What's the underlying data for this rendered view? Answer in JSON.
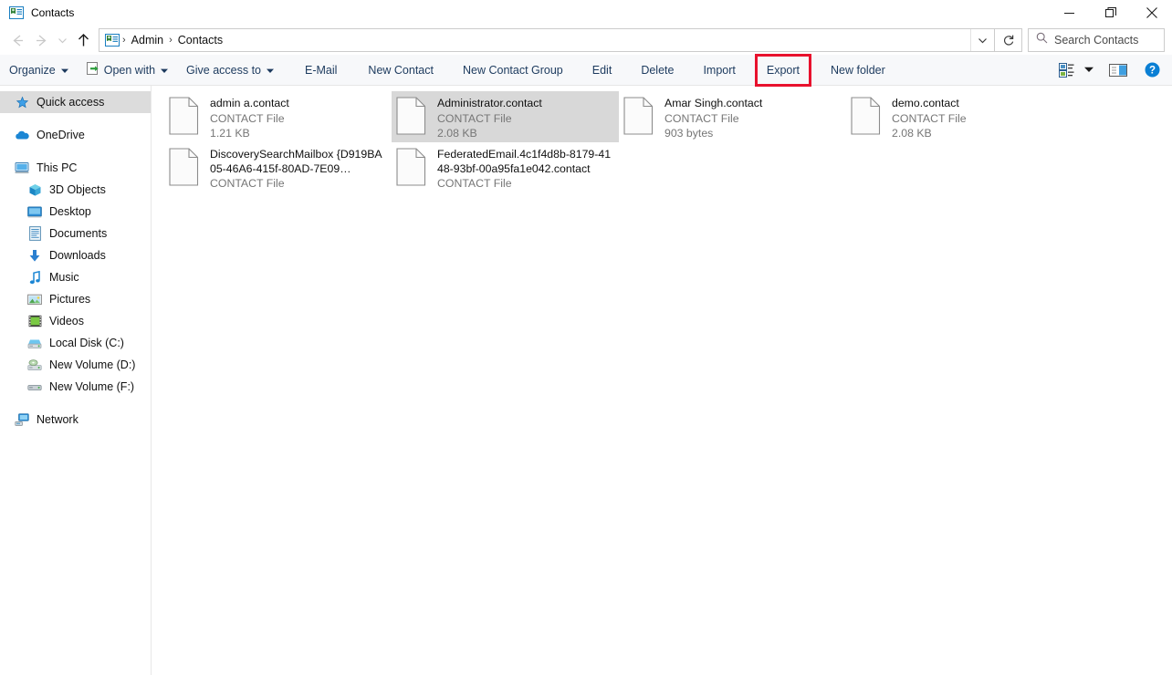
{
  "window": {
    "title": "Contacts",
    "title_icon": "contact-card-icon",
    "controls": {
      "minimize": "minimize-icon",
      "maximize": "restore-icon",
      "close": "close-icon"
    }
  },
  "addressbar": {
    "back": "back-arrow-icon",
    "forward": "forward-arrow-icon",
    "recent": "chevron-down-icon",
    "up": "up-arrow-icon",
    "path_icon": "contact-card-icon",
    "crumbs": [
      "Admin",
      "Contacts"
    ],
    "separator": "›",
    "dropdown": "chevron-down-icon",
    "refresh": "refresh-icon"
  },
  "search": {
    "icon": "search-icon",
    "placeholder": "Search Contacts",
    "value": ""
  },
  "toolbar": {
    "items": [
      {
        "label": "Organize",
        "caret": true,
        "icon": null
      },
      {
        "label": "Open with",
        "caret": true,
        "icon": "open-with-icon"
      },
      {
        "label": "Give access to",
        "caret": true,
        "icon": null
      },
      {
        "label": "E-Mail",
        "caret": false,
        "icon": null
      },
      {
        "label": "New Contact",
        "caret": false,
        "icon": null
      },
      {
        "label": "New Contact Group",
        "caret": false,
        "icon": null
      },
      {
        "label": "Edit",
        "caret": false,
        "icon": null
      },
      {
        "label": "Delete",
        "caret": false,
        "icon": null
      },
      {
        "label": "Import",
        "caret": false,
        "icon": null
      },
      {
        "label": "Export",
        "caret": false,
        "icon": null,
        "highlighted": true
      },
      {
        "label": "New folder",
        "caret": false,
        "icon": null
      }
    ],
    "right_icons": [
      "view-options-icon",
      "view-options-caret-icon",
      "preview-pane-icon",
      "help-icon"
    ],
    "highlight_color": "#e8112d"
  },
  "sidebar": {
    "items": [
      {
        "label": "Quick access",
        "icon": "star-pin-icon",
        "selected": true,
        "indent": false,
        "gap_before": false
      },
      {
        "label": "OneDrive",
        "icon": "cloud-icon",
        "selected": false,
        "indent": false,
        "gap_before": true
      },
      {
        "label": "This PC",
        "icon": "monitor-icon",
        "selected": false,
        "indent": false,
        "gap_before": true
      },
      {
        "label": "3D Objects",
        "icon": "cube-icon",
        "selected": false,
        "indent": true,
        "gap_before": false
      },
      {
        "label": "Desktop",
        "icon": "desktop-icon",
        "selected": false,
        "indent": true,
        "gap_before": false
      },
      {
        "label": "Documents",
        "icon": "document-icon",
        "selected": false,
        "indent": true,
        "gap_before": false
      },
      {
        "label": "Downloads",
        "icon": "download-icon",
        "selected": false,
        "indent": true,
        "gap_before": false
      },
      {
        "label": "Music",
        "icon": "music-note-icon",
        "selected": false,
        "indent": true,
        "gap_before": false
      },
      {
        "label": "Pictures",
        "icon": "picture-icon",
        "selected": false,
        "indent": true,
        "gap_before": false
      },
      {
        "label": "Videos",
        "icon": "video-icon",
        "selected": false,
        "indent": true,
        "gap_before": false
      },
      {
        "label": "Local Disk (C:)",
        "icon": "hard-drive-icon",
        "selected": false,
        "indent": true,
        "gap_before": false
      },
      {
        "label": "New Volume (D:)",
        "icon": "optical-drive-icon",
        "selected": false,
        "indent": true,
        "gap_before": false
      },
      {
        "label": "New Volume (F:)",
        "icon": "removable-drive-icon",
        "selected": false,
        "indent": true,
        "gap_before": false
      },
      {
        "label": "Network",
        "icon": "network-icon",
        "selected": false,
        "indent": false,
        "gap_before": true
      }
    ]
  },
  "files": {
    "icon": "generic-file-icon",
    "items": [
      {
        "name": "admin a.contact",
        "type": "CONTACT File",
        "size": "1.21 KB",
        "selected": false
      },
      {
        "name": "Administrator.contact",
        "type": "CONTACT File",
        "size": "2.08 KB",
        "selected": true
      },
      {
        "name": "Amar Singh.contact",
        "type": "CONTACT File",
        "size": "903 bytes",
        "selected": false
      },
      {
        "name": "demo.contact",
        "type": "CONTACT File",
        "size": "2.08 KB",
        "selected": false
      },
      {
        "name": "DiscoverySearchMailbox {D919BA05-46A6-415f-80AD-7E09…",
        "type": "CONTACT File",
        "size": "",
        "selected": false
      },
      {
        "name": "FederatedEmail.4c1f4d8b-8179-4148-93bf-00a95fa1e042.contact",
        "type": "CONTACT File",
        "size": "",
        "selected": false
      }
    ]
  }
}
